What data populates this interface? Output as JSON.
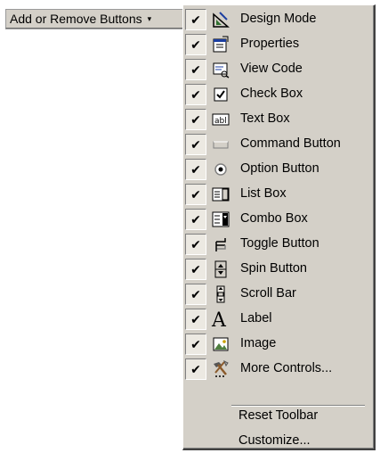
{
  "toolbar": {
    "dropdown_label": "Add or Remove Buttons",
    "dropdown_arrow": "▾"
  },
  "menu": {
    "items": [
      {
        "label": "Design Mode",
        "checked": true,
        "icon": "design-mode-icon"
      },
      {
        "label": "Properties",
        "checked": true,
        "icon": "properties-icon"
      },
      {
        "label": "View Code",
        "checked": true,
        "icon": "view-code-icon"
      },
      {
        "label": "Check Box",
        "checked": true,
        "icon": "check-box-icon"
      },
      {
        "label": "Text Box",
        "checked": true,
        "icon": "text-box-icon"
      },
      {
        "label": "Command Button",
        "checked": true,
        "icon": "command-button-icon"
      },
      {
        "label": "Option Button",
        "checked": true,
        "icon": "option-button-icon"
      },
      {
        "label": "List Box",
        "checked": true,
        "icon": "list-box-icon"
      },
      {
        "label": "Combo Box",
        "checked": true,
        "icon": "combo-box-icon"
      },
      {
        "label": "Toggle Button",
        "checked": true,
        "icon": "toggle-button-icon"
      },
      {
        "label": "Spin Button",
        "checked": true,
        "icon": "spin-button-icon"
      },
      {
        "label": "Scroll Bar",
        "checked": true,
        "icon": "scroll-bar-icon"
      },
      {
        "label": "Label",
        "checked": true,
        "icon": "label-icon"
      },
      {
        "label": "Image",
        "checked": true,
        "icon": "image-icon"
      },
      {
        "label": "More Controls...",
        "checked": true,
        "icon": "more-controls-icon"
      }
    ],
    "check_glyph": "✔",
    "reset_label": "Reset Toolbar",
    "customize_label": "Customize..."
  }
}
